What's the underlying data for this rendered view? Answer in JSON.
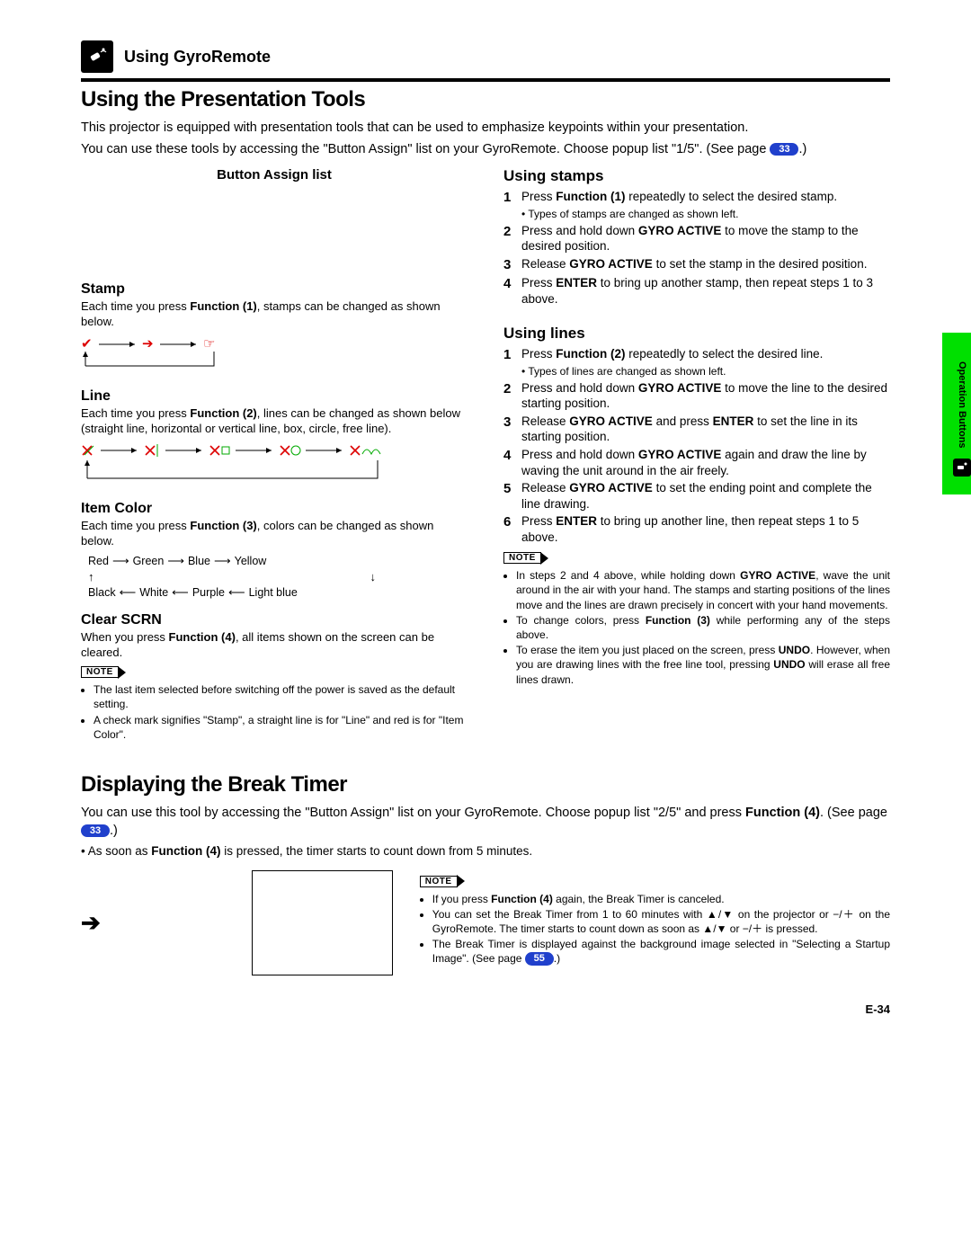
{
  "header": {
    "section": "Using GyroRemote"
  },
  "sideTab": "Operation Buttons",
  "h1a": "Using the Presentation Tools",
  "intro1": "This projector is equipped with presentation tools that can be used to emphasize keypoints within your presentation.",
  "intro2a": "You can use these tools by accessing the \"Button Assign\" list on your GyroRemote. Choose popup list \"1/5\". (See page ",
  "intro2_page": "33",
  "intro2b": ".)",
  "left": {
    "buttonAssign": "Button Assign list",
    "stamp_h": "Stamp",
    "stamp_t1": "Each time you press ",
    "stamp_fn": "Function (1)",
    "stamp_t2": ", stamps can be changed as shown below.",
    "line_h": "Line",
    "line_t1": "Each time you press ",
    "line_fn": "Function (2)",
    "line_t2": ", lines can be changed as shown below (straight line, horizontal or vertical line, box, circle, free line).",
    "color_h": "Item Color",
    "color_t1": "Each time you press ",
    "color_fn": "Function (3)",
    "color_t2": ", colors can be changed as shown below.",
    "colors1": [
      "Red",
      "Green",
      "Blue",
      "Yellow"
    ],
    "colors2": [
      "Black",
      "White",
      "Purple",
      "Light blue"
    ],
    "clear_h": "Clear SCRN",
    "clear_t1": "When you press ",
    "clear_fn": "Function (4)",
    "clear_t2": ", all items shown on the screen can be cleared.",
    "note_label": "NOTE",
    "note1": "The last item selected before switching off the power is saved as the default setting.",
    "note2": "A check mark signifies \"Stamp\", a straight line is for \"Line\" and red is for \"Item Color\"."
  },
  "right": {
    "stamps_h": "Using stamps",
    "s1a": "Press ",
    "s1b": "Function (1)",
    "s1c": " repeatedly to select the desired stamp.",
    "s1_sub": "Types of stamps are changed as shown left.",
    "s2a": "Press and hold down ",
    "s2b": "GYRO ACTIVE",
    "s2c": " to move the stamp to the desired position.",
    "s3a": "Release ",
    "s3b": "GYRO ACTIVE",
    "s3c": " to set the stamp in the desired position.",
    "s4a": "Press ",
    "s4b": "ENTER",
    "s4c": " to bring up another stamp, then repeat steps 1 to 3 above.",
    "lines_h": "Using lines",
    "l1a": "Press ",
    "l1b": "Function (2)",
    "l1c": " repeatedly to select the desired line.",
    "l1_sub": "Types of lines are changed as shown left.",
    "l2a": "Press and hold down ",
    "l2b": "GYRO ACTIVE",
    "l2c": " to move the line to the desired starting position.",
    "l3a": "Release ",
    "l3b": "GYRO ACTIVE",
    "l3c": " and press ",
    "l3d": "ENTER",
    "l3e": " to set the line in its starting position.",
    "l4a": "Press and hold down ",
    "l4b": "GYRO ACTIVE",
    "l4c": " again and draw the line by waving the unit around in the air freely.",
    "l5a": "Release ",
    "l5b": "GYRO ACTIVE",
    "l5c": " to set the ending point and complete the line drawing.",
    "l6a": "Press ",
    "l6b": "ENTER",
    "l6c": " to bring up another line, then repeat steps 1 to 5 above.",
    "rnote1a": "In steps 2 and 4 above, while holding down ",
    "rnote1b": "GYRO ACTIVE",
    "rnote1c": ", wave the unit around in the air with your hand. The stamps and starting positions of the lines move and the lines are drawn precisely in concert with your hand movements.",
    "rnote2a": "To change colors, press ",
    "rnote2b": "Function (3)",
    "rnote2c": " while performing any of the steps above.",
    "rnote3a": "To erase the item you just placed on the screen, press ",
    "rnote3b": "UNDO",
    "rnote3c": ". However, when you are drawing lines with the free line tool, pressing ",
    "rnote3d": "UNDO",
    "rnote3e": " will erase all free lines drawn."
  },
  "h1b": "Displaying the Break Timer",
  "break_intro1": "You can use this tool by accessing the \"Button Assign\" list on your GyroRemote.  Choose popup list \"2/5\" and press ",
  "break_fn": "Function (4)",
  "break_intro2": ". (See page ",
  "break_page": "33",
  "break_intro3": ".)",
  "break_bullet1a": "As soon as ",
  "break_bullet1b": "Function (4)",
  "break_bullet1c": "  is pressed, the timer starts to count down from 5 minutes.",
  "bnotes": {
    "n1a": "If you press ",
    "n1b": "Function (4)",
    "n1c": " again, the Break Timer is canceled.",
    "n2a": "You can set the Break Timer from 1 to 60 minutes with ▲/▼ on the projector or −/＋ on the GyroRemote. The timer starts to count down as soon as ▲/▼ or −/＋ is pressed.",
    "n3a": "The Break Timer is displayed against the background image selected in \"Selecting a Startup Image\". (See page ",
    "n3_page": "55",
    "n3b": ".)"
  },
  "footer": "E-34"
}
